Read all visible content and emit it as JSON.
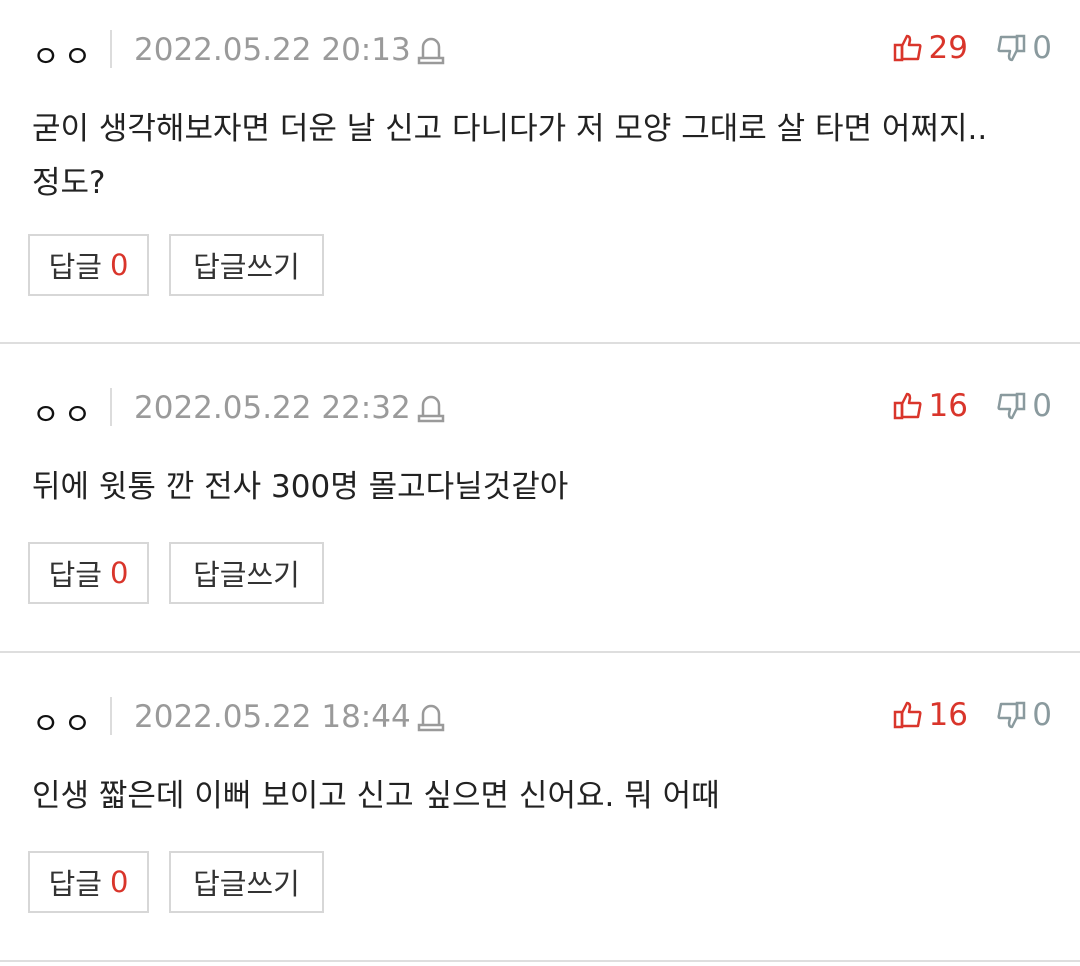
{
  "comments": [
    {
      "author": "ㅇㅇ",
      "date": "2022.05.22 20:13",
      "likes": "29",
      "dislikes": "0",
      "text_lines": [
        "굳이 생각해보자면 더운 날 신고 다니다가 저 모양 그대로 살 타면 어쩌지..",
        "정도?"
      ],
      "reply_label": "답글",
      "reply_count": "0",
      "write_label": "답글쓰기"
    },
    {
      "author": "ㅇㅇ",
      "date": "2022.05.22 22:32",
      "likes": "16",
      "dislikes": "0",
      "text_lines": [
        "뒤에 윗통 깐 전사 300명 몰고다닐것같아"
      ],
      "reply_label": "답글",
      "reply_count": "0",
      "write_label": "답글쓰기"
    },
    {
      "author": "ㅇㅇ",
      "date": "2022.05.22 18:44",
      "likes": "16",
      "dislikes": "0",
      "text_lines": [
        "인생 짧은데 이뻐 보이고 신고 싶으면 신어요. 뭐 어때"
      ],
      "reply_label": "답글",
      "reply_count": "0",
      "write_label": "답글쓰기"
    }
  ],
  "icons": {
    "like": "thumbs-up-icon",
    "dislike": "thumbs-down-icon",
    "report": "siren-icon"
  },
  "colors": {
    "like": "#d9352b",
    "dislike": "#8a9a9e",
    "date": "#9a9a9a"
  }
}
